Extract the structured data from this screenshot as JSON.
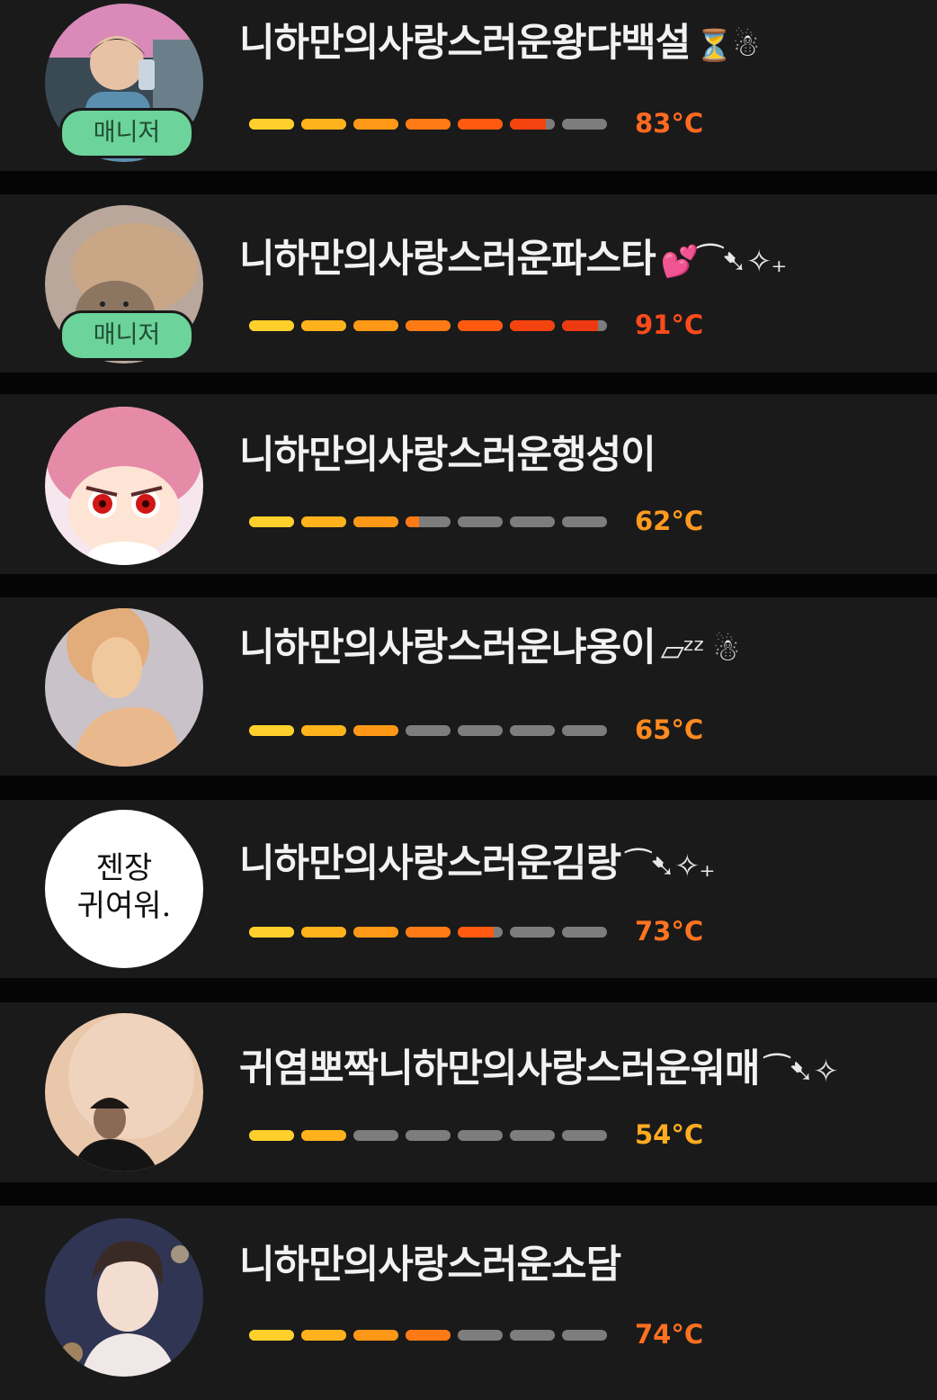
{
  "colors": {
    "background": "#050505",
    "card": "#1a1a1a",
    "badge": "#6cd39a",
    "bar_empty": "#7d7d7d",
    "bar_gradient": [
      "#ffd02b",
      "#ffb21c",
      "#ff9816",
      "#ff7a14",
      "#ff5a10",
      "#f4430f",
      "#ee3a10"
    ]
  },
  "users": [
    {
      "name": "니하만의사랑스러운왕댜백설",
      "suffix": "⏳☃",
      "badge": "매니저",
      "temperature": "83°C",
      "temperature_value": 83,
      "temp_color": "#ff6a21",
      "avatar": "photo-boy-selfie"
    },
    {
      "name": "니하만의사랑스러운파스타",
      "suffix": "💕⁀➷✧₊",
      "badge": "매니저",
      "temperature": "91°C",
      "temperature_value": 91,
      "temp_color": "#ff4a1c",
      "avatar": "photo-cat"
    },
    {
      "name": "니하만의사랑스러운행성이",
      "suffix": "",
      "badge": "",
      "temperature": "62°C",
      "temperature_value": 62,
      "temp_color": "#ff9a21",
      "avatar": "cartoon-pink-hair"
    },
    {
      "name": "니하만의사랑스러운냐옹이",
      "suffix": "▱ᶻᶻ ☃",
      "badge": "",
      "temperature": "65°C",
      "temperature_value": 65,
      "temp_color": "#ff8a21",
      "avatar": "photo-portrait-warm"
    },
    {
      "name": "니하만의사랑스러운김랑",
      "suffix": "⁀➷✧₊",
      "badge": "",
      "temperature": "73°C",
      "temperature_value": 73,
      "temp_color": "#ff7421",
      "avatar": "text-image",
      "avatar_text": [
        "젠장",
        "귀여워."
      ]
    },
    {
      "name": "귀염뽀짝니하만의사랑스러운워매",
      "suffix": "⁀➷✧",
      "badge": "",
      "temperature": "54°C",
      "temperature_value": 54,
      "temp_color": "#ffac21",
      "avatar": "photo-man-portrait"
    },
    {
      "name": "니하만의사랑스러운소담",
      "suffix": "",
      "badge": "",
      "temperature": "74°C",
      "temperature_value": 74,
      "temp_color": "#ff7021",
      "avatar": "illustration-boy"
    }
  ]
}
